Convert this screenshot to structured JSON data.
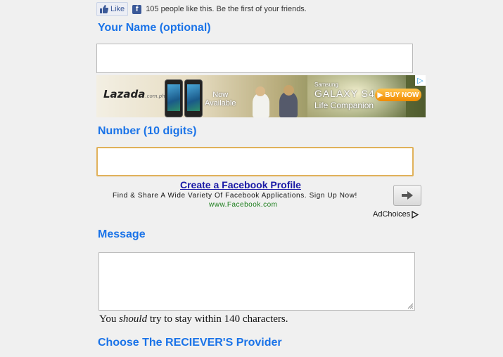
{
  "fb_like": {
    "button_label": "Like",
    "icon": "thumbs-up-icon",
    "brand_icon": "facebook-f-icon",
    "brand_color": "#3b5998",
    "text": "105 people like this. Be the first of your friends."
  },
  "form": {
    "name_label": "Your Name (optional)",
    "name_value": "",
    "number_label": "Number (10 digits)",
    "number_value": "",
    "message_label": "Message",
    "message_value": "",
    "note_before": "You ",
    "note_em": "should",
    "note_after": " try to stay within 140 characters.",
    "provider_label": "Choose The RECIEVER'S Provider",
    "label_color": "#1a73e8",
    "focus_border_color": "#e0b15a"
  },
  "banner_ad": {
    "brand": "Lazada",
    "brand_domain": ".com.ph",
    "now_line1": "Now",
    "now_line2": "Available",
    "maker": "Samsung",
    "product": "GALAXY S4",
    "tagline": "Life Companion",
    "cta": "BUY NOW",
    "adchoices_icon": "adchoices-triangle-icon"
  },
  "text_ad": {
    "title": "Create a Facebook Profile",
    "description": "Find & Share A Wide Variety Of Facebook Applications. Sign Up Now!",
    "url": "www.Facebook.com",
    "go_icon": "arrow-right-icon",
    "adchoices_label": "AdChoices",
    "adchoices_icon": "adchoices-triangle-icon"
  }
}
